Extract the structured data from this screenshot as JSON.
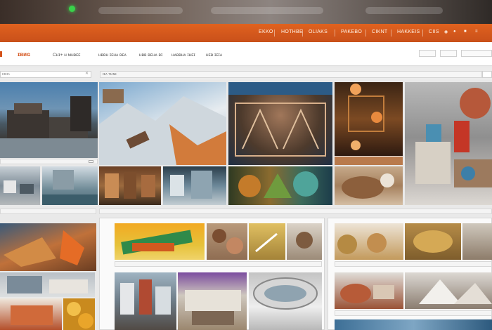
{
  "topnav": {
    "items": [
      "EKKO",
      "HOTHBE",
      "OLIAKS",
      "PAKEBO",
      "CIKNT",
      "HAKKEIS",
      "CIIS"
    ]
  },
  "subnav": {
    "logo": "ɪʙиɢ",
    "items": [
      "Cʜɪ+ ʜ ᴍʜʙᴇᴇ",
      "ʜʙʙʜ ɪᴇʜᴀ ʙᴇᴀ",
      "ʜʙʙ ʙᴇʜᴀ ʙɪ",
      "ʜᴀʙʙʜᴀ ɪʜᴇɪ",
      "ʜᴇʙ ɪᴇɪᴀ"
    ]
  },
  "search": {
    "left_placeholder": "ᴇɪᴇɪᴀ",
    "filter_placeholder": "ɪᴇᴀ ᴛɪᴀɴᴇ"
  },
  "icons": {
    "clear": "close-icon"
  },
  "colors": {
    "brand_orange": "#d4521a",
    "header_orange": "#e0621f",
    "status_green": "#39d24a",
    "page_bg": "#e9e9e9"
  }
}
